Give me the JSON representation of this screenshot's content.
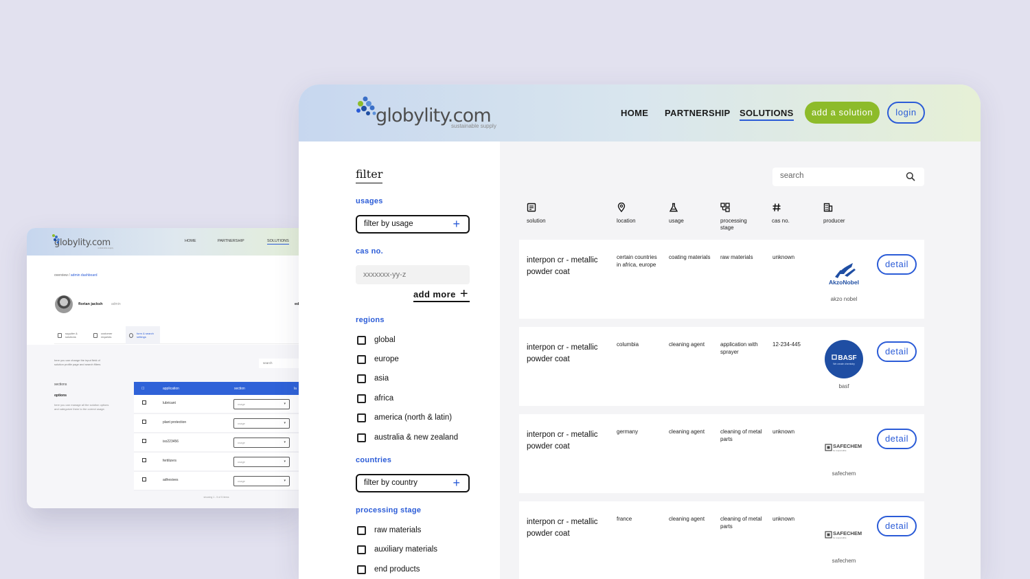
{
  "back_window": {
    "logo": "globylity.com",
    "logo_sub": "sustainable supply",
    "nav": [
      "HOME",
      "PARTNERSHIP",
      "SOLUTIONS"
    ],
    "breadcrumb": {
      "first": "overview",
      "sep": "/",
      "current": "admin dashboard"
    },
    "user": {
      "name": "florian jacksh",
      "role": "admin"
    },
    "edge_text": "ed",
    "tabs": [
      "supplier & solutions",
      "customer requests",
      "form & search settings"
    ],
    "description": "here you can change the input field of solution profile page and search filters",
    "search_placeholder": "search",
    "sections_label": "sections",
    "options_label": "options",
    "options_desc": "here you can manage all the solution options and categorize them to the correct usage.",
    "table": {
      "headers": [
        "application",
        "section",
        "la"
      ],
      "rows": [
        {
          "label": "lubricant",
          "select": "usage"
        },
        {
          "label": "plant protection",
          "select": "usage"
        },
        {
          "label": "iso223456",
          "select": "usage"
        },
        {
          "label": "fertilizers",
          "select": "usage"
        },
        {
          "label": "adhesives",
          "select": "usage"
        }
      ],
      "footer": "showing 1 - 5 of 5 items"
    }
  },
  "header": {
    "logo_text": "globylity.com",
    "logo_sub": "sustainable supply",
    "nav": {
      "home": "HOME",
      "partnership": "PARTNERSHIP",
      "solutions": "SOLUTIONS"
    },
    "add_solution": "add a solution",
    "login": "login"
  },
  "filter": {
    "title": "filter",
    "usages_label": "usages",
    "usage_button": "filter by usage",
    "cas_label": "cas no.",
    "cas_placeholder": "xxxxxxx-yy-z",
    "add_more": "add more",
    "regions_label": "regions",
    "regions": [
      "global",
      "europe",
      "asia",
      "africa",
      "america (north & latin)",
      "australia & new zealand"
    ],
    "countries_label": "countries",
    "country_button": "filter by country",
    "processing_label": "processing stage",
    "processing": [
      "raw materials",
      "auxiliary materials",
      "end products"
    ]
  },
  "search": {
    "placeholder": "search"
  },
  "columns": {
    "solution": "solution",
    "location": "location",
    "usage": "usage",
    "processing": "processing stage",
    "cas": "cas no.",
    "producer": "producer"
  },
  "results": [
    {
      "solution": "interpon cr - metallic powder coat",
      "location": "certain countries in africa, europe",
      "usage": "coating materials",
      "processing": "raw materials",
      "cas": "unknown",
      "producer": "akzo nobel",
      "logo": "akzonobel-logo",
      "detail": "detail"
    },
    {
      "solution": "interpon cr - metallic powder coat",
      "location": "columbia",
      "usage": "cleaning agent",
      "processing": "application with sprayer",
      "cas": "12-234-445",
      "producer": "basf",
      "logo": "basf-logo",
      "detail": "detail"
    },
    {
      "solution": "interpon cr - metallic powder coat",
      "location": "germany",
      "usage": "cleaning agent",
      "processing": "cleaning of metal parts",
      "cas": "unknown",
      "producer": "safechem",
      "logo": "safechem-logo",
      "detail": "detail"
    },
    {
      "solution": "interpon cr - metallic powder coat",
      "location": "france",
      "usage": "cleaning agent",
      "processing": "cleaning of metal parts",
      "cas": "unknown",
      "producer": "safechem",
      "logo": "safechem-logo",
      "detail": "detail"
    }
  ],
  "logos": {
    "akzonobel": "AkzoNobel",
    "basf": "BASF",
    "basf_tag": "We create chemistry",
    "safechem": "SAFECHEM",
    "safechem_tag": "be responsible"
  },
  "colors": {
    "accent": "#2a5bd7",
    "add_button": "#8dbb2a",
    "background": "#e2e1ef",
    "basf": "#1f4ea3"
  }
}
